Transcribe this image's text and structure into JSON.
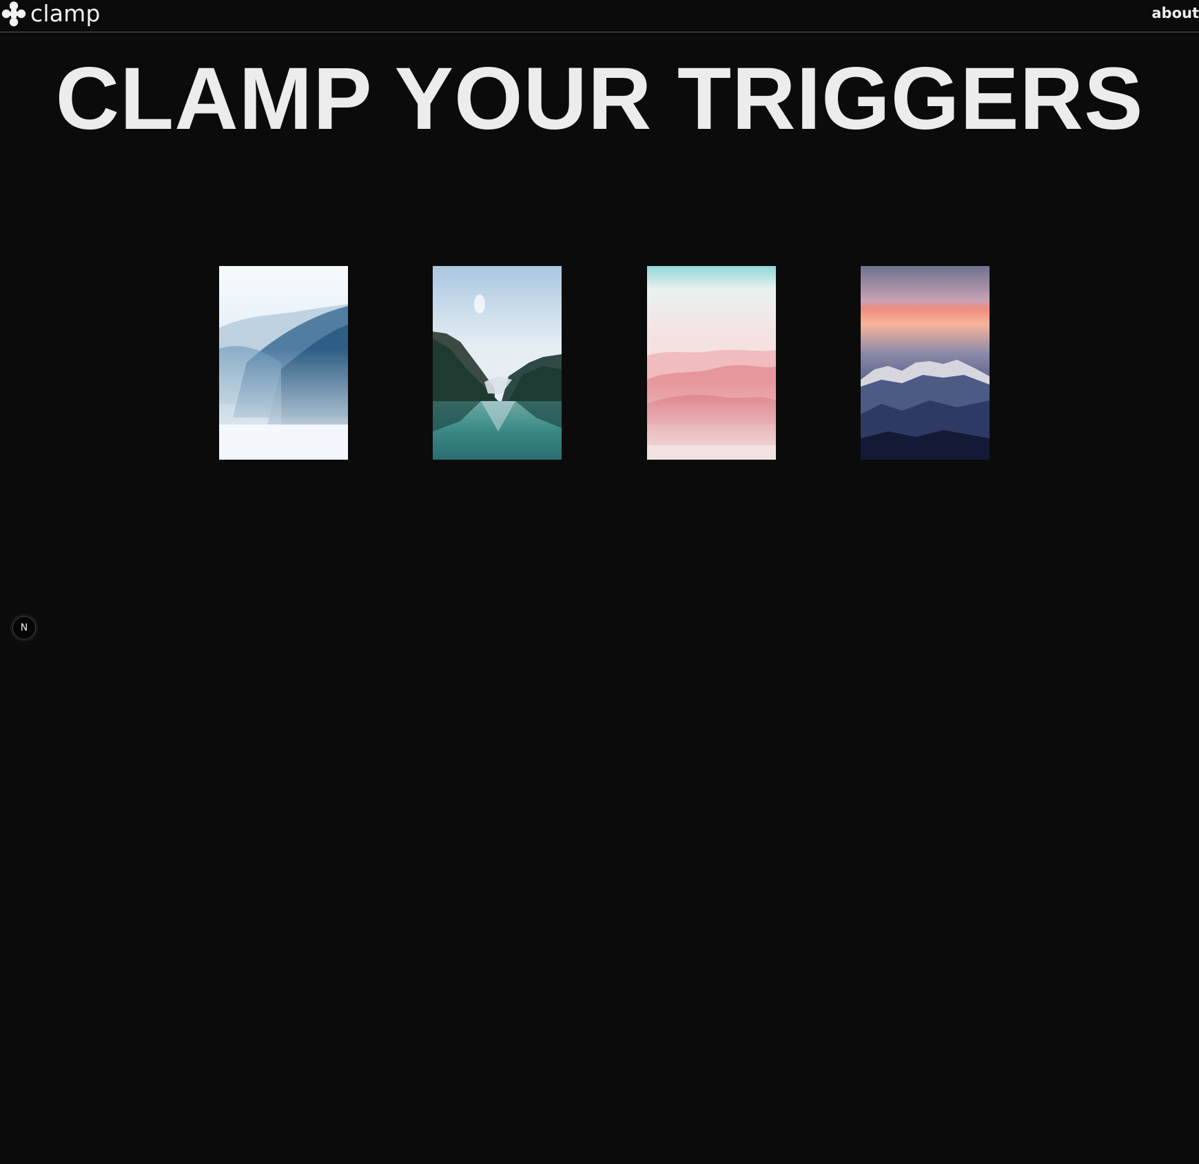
{
  "header": {
    "brand": "clamp",
    "brand_icon": "clamp-logo-icon",
    "nav_about": "about"
  },
  "hero": {
    "title": "CLAMP YOUR TRIGGERS"
  },
  "gallery": {
    "images": [
      {
        "name": "misty-blue-mountains-image",
        "palette": [
          "#f4f8fc",
          "#2f5f86",
          "#e8f1f8"
        ]
      },
      {
        "name": "mountain-lake-reflection-image",
        "palette": [
          "#c9dcec",
          "#2a4a44",
          "#3f8c8a"
        ]
      },
      {
        "name": "pink-misty-ridges-image",
        "palette": [
          "#8fd6d6",
          "#e98c95",
          "#f1dede"
        ]
      },
      {
        "name": "sunset-alpine-peaks-image",
        "palette": [
          "#f08a7c",
          "#4c5a86",
          "#13193a"
        ]
      }
    ]
  },
  "dev_badge": {
    "label": "N",
    "icon": "nextjs-icon"
  },
  "colors": {
    "background": "#0b0b0c",
    "text": "#ececec",
    "divider": "#5a5a5c"
  }
}
